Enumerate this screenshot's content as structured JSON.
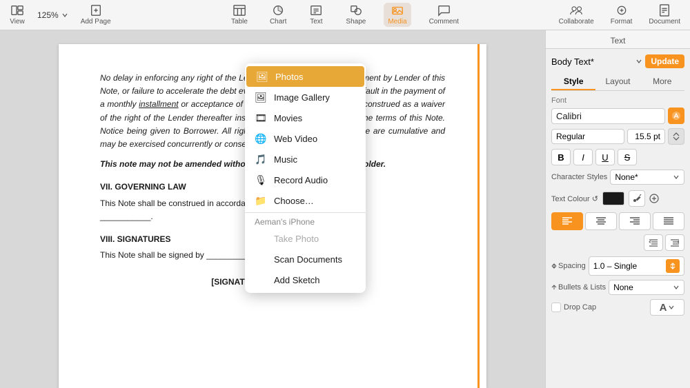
{
  "toolbar": {
    "view_label": "View",
    "zoom_value": "125%",
    "add_page_label": "Add Page",
    "table_label": "Table",
    "chart_label": "Chart",
    "text_label": "Text",
    "shape_label": "Shape",
    "media_label": "Media",
    "comment_label": "Comment",
    "collaborate_label": "Collaborate",
    "format_label": "Format",
    "document_label": "Document"
  },
  "dropdown": {
    "items": [
      {
        "id": "photos",
        "label": "Photos",
        "icon": "🖼",
        "active": true
      },
      {
        "id": "image-gallery",
        "label": "Image Gallery",
        "icon": "🖼"
      },
      {
        "id": "movies",
        "label": "Movies",
        "icon": "🎞"
      },
      {
        "id": "web-video",
        "label": "Web Video",
        "icon": "🌐"
      },
      {
        "id": "music",
        "label": "Music",
        "icon": "🎵"
      },
      {
        "id": "record-audio",
        "label": "Record Audio",
        "icon": "🎙"
      },
      {
        "id": "choose",
        "label": "Choose…",
        "icon": "📁"
      },
      {
        "id": "section-header",
        "label": "Aeman's iPhone",
        "type": "section"
      },
      {
        "id": "take-photo",
        "label": "Take Photo",
        "icon": ""
      },
      {
        "id": "scan-documents",
        "label": "Scan Documents",
        "icon": ""
      },
      {
        "id": "add-sketch",
        "label": "Add Sketch",
        "icon": ""
      }
    ]
  },
  "panel": {
    "header": "Text",
    "style_name": "Body Text*",
    "update_btn": "Update",
    "tabs": [
      "Style",
      "Layout",
      "More"
    ],
    "active_tab": "Style",
    "font": {
      "label": "Font",
      "name": "Calibri",
      "style": "Regular",
      "size": "15.5 pt"
    },
    "format_buttons": [
      "B",
      "I",
      "U",
      "S"
    ],
    "char_styles_label": "Character Styles",
    "char_styles_value": "None*",
    "text_color_label": "Text Colour ↺",
    "alignment": {
      "left": "≡",
      "center": "≡",
      "right": "≡",
      "justify": "≡"
    },
    "spacing_label": "Spacing",
    "spacing_value": "1.0 – Single",
    "bullets_label": "Bullets & Lists",
    "bullets_value": "None",
    "dropcap_label": "Drop Cap"
  },
  "document": {
    "paragraphs": [
      "No delay in enforcing any right of the Lender under this Note, or assignment by Lender of this Note, or failure to accelerate the debt evidenced hereby by reason of default in the payment of a monthly installment or acceptance of a past- due installment shall be construed as a waiver of the right of the Lender thereafter insist upon strict compliance with the terms of this Note. Notice being given to Borrower. All rights of the Lender under this Note are cumulative and may be exercised concurrently or consecutively at the Lender's option.",
      "This note may not be amended without the written consent of the holder.",
      "VII. GOVERNING LAW",
      "This Note shall be construed in accordance with the laws of the State of ___________.",
      "VIII. SIGNATURES",
      "This Note shall be signed by ___________ and ___________.",
      "[SIGNATURE PAGE FOLLOWS]"
    ]
  }
}
